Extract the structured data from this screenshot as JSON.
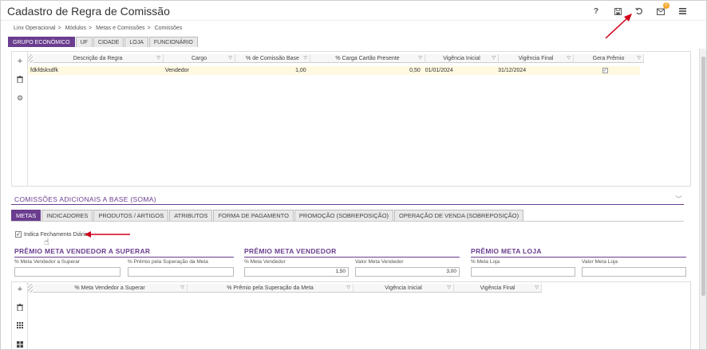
{
  "header": {
    "title": "Cadastro de Regra de Comissão",
    "notification_count": "0"
  },
  "breadcrumb": [
    "Linx Operacional",
    "Módulos",
    "Metas e Comissões",
    "Comissões"
  ],
  "top_tabs": [
    "GRUPO ECONÔMICO",
    "UF",
    "CIDADE",
    "LOJA",
    "FUNCIONÁRIO"
  ],
  "grid": {
    "columns": [
      "Descrição da Regra",
      "Cargo",
      "% de Comissão Base",
      "% Carga Cartão Presente",
      "Vigência Inicial",
      "Vigência Final",
      "Gera Prêmio"
    ],
    "row": {
      "descricao": "fdkfdsksdfk",
      "cargo": "Vendedor",
      "comissao": "1,00",
      "carga": "0,50",
      "vig_ini": "01/01/2024",
      "vig_fim": "31/12/2024",
      "gera_premio": "✓"
    }
  },
  "section": {
    "title": "COMISSÕES ADICIONAIS A BASE (SOMA)"
  },
  "bottom_tabs": [
    "METAS",
    "INDICADORES",
    "PRODUTOS / ARTIGOS",
    "ATRIBUTOS",
    "FORMA DE PAGAMENTO",
    "PROMOÇÃO (SOBREPOSIÇÃO)",
    "OPERAÇÃO DE VENDA (SOBREPOSIÇÃO)"
  ],
  "indica_fechamento": {
    "label": "Indica Fechamento Diário",
    "checked": "✓"
  },
  "premio_vendedor_superar": {
    "title": "PRÊMIO META VENDEDOR A SUPERAR",
    "field1_label": "% Meta Vendedor a Superar",
    "field2_label": "% Prêmio pela Superação da Meta"
  },
  "premio_vendedor": {
    "title": "PRÊMIO META VENDEDOR",
    "field1_label": "% Meta Vendedor",
    "field1_value": "1,50",
    "field2_label": "Valor Meta Vendedor",
    "field2_value": "3,00"
  },
  "premio_loja": {
    "title": "PRÊMIO META LOJA",
    "field1_label": "% Meta Loja",
    "field2_label": "Valor Meta Loja"
  },
  "grid2": {
    "columns": [
      "% Meta Vendedor a Superar",
      "% Prêmio pela Superação da Meta",
      "Vigência Inicial",
      "Vigência Final"
    ]
  },
  "colors": {
    "accent": "#6a3d8f",
    "row_highlight": "#fff9e1",
    "arrow": "#d0021b"
  }
}
